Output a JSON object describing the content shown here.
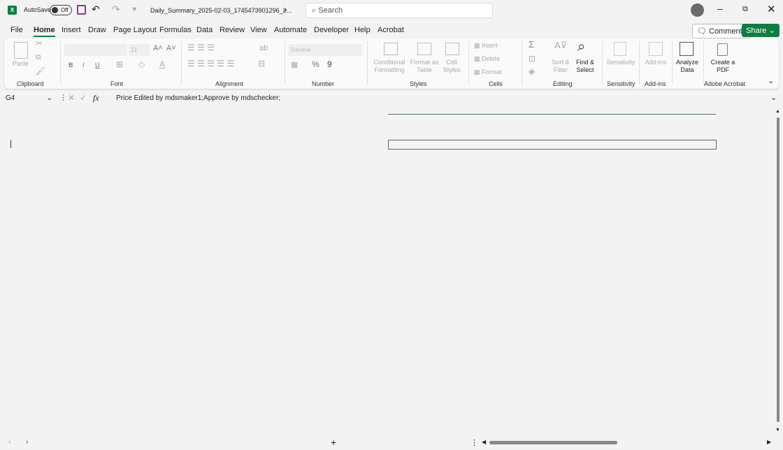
{
  "titlebar": {
    "app_icon": "X",
    "autosave_label": "AutoSave",
    "autosave_state": "Off",
    "filename": "Daily_Summary_2025-02-03_1745473901296_2...",
    "search_placeholder": "Search"
  },
  "menu": [
    "File",
    "Home",
    "Insert",
    "Draw",
    "Page Layout",
    "Formulas",
    "Data",
    "Review",
    "View",
    "Automate",
    "Developer",
    "Help",
    "Acrobat"
  ],
  "actions": {
    "comments": "Comments",
    "share": "Share"
  },
  "ribbon": {
    "clipboard": {
      "paste": "Paste",
      "label": "Clipboard"
    },
    "font": {
      "size": "11",
      "label": "Font",
      "bold": "B",
      "italic": "I",
      "underline": "U"
    },
    "alignment": {
      "label": "Alignment"
    },
    "number": {
      "format": "General",
      "label": "Number",
      "percent": "%",
      "comma": "9"
    },
    "styles": {
      "conditional": "Conditional Formatting",
      "format_table": "Format as Table",
      "cell_styles": "Cell Styles",
      "label": "Styles"
    },
    "cells": {
      "insert": "Insert",
      "delete": "Delete",
      "format": "Format",
      "label": "Cells"
    },
    "editing": {
      "sort": "Sort & Filter",
      "find": "Find & Select",
      "label": "Editing",
      "sum": "Σ"
    },
    "sensitivity": {
      "btn": "Sensitivity",
      "label": "Sensitivity"
    },
    "addins": {
      "btn": "Add-ins",
      "label": "Add-ins"
    },
    "analyze": {
      "btn": "Analyze Data"
    },
    "acrobat": {
      "btn": "Create a PDF",
      "label": "Adobe Acrobat"
    }
  },
  "formula_bar": {
    "cell": "G4",
    "fx": "fx",
    "content": "Price Edited by mdsmaker1;Approve by mdschecker;"
  }
}
